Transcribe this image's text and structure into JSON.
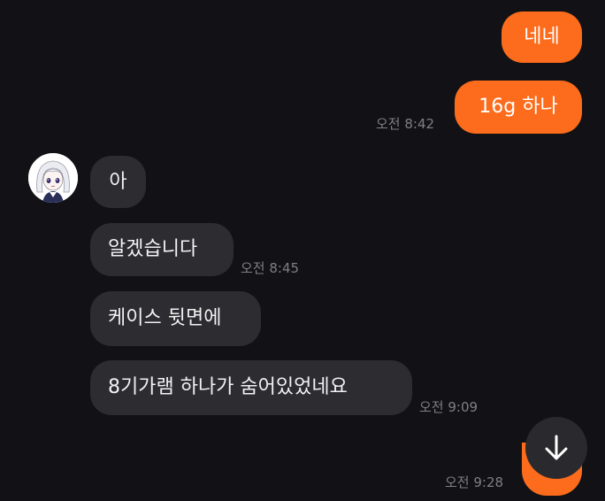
{
  "colors": {
    "background": "#121216",
    "outgoing_bubble": "#fc6c1c",
    "incoming_bubble": "#2c2c31",
    "timestamp": "#7e7e84"
  },
  "messages": [
    {
      "direction": "outgoing",
      "text": "네네",
      "time": ""
    },
    {
      "direction": "outgoing",
      "text": "16g 하나",
      "time": "오전 8:42"
    },
    {
      "direction": "incoming",
      "text": "아",
      "time": ""
    },
    {
      "direction": "incoming",
      "text": "알겠습니다",
      "time": "오전 8:45"
    },
    {
      "direction": "incoming",
      "text": "케이스 뒷면에",
      "time": ""
    },
    {
      "direction": "incoming",
      "text": "8기가램 하나가 숨어있었네요",
      "time": "오전 9:09"
    },
    {
      "direction": "outgoing",
      "text": "",
      "time": "오전 9:28"
    }
  ],
  "avatar": {
    "icon": "anime-girl-avatar-icon"
  },
  "scroll_button": {
    "icon": "arrow-down-icon"
  }
}
